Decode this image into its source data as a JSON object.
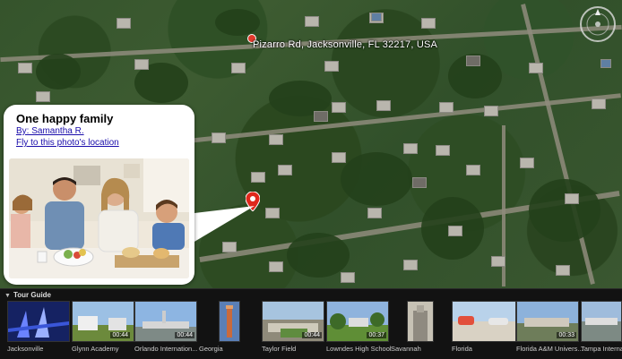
{
  "map": {
    "address_label": "Pizarro Rd, Jacksonville, FL 32217, USA"
  },
  "balloon": {
    "title": "One happy family",
    "author_link": "By: Samantha R.",
    "fly_link": "Fly to this photo's location"
  },
  "tour_guide": {
    "header": "Tour Guide",
    "items": [
      {
        "caption": "Jacksonville",
        "duration": ""
      },
      {
        "caption": "Glynn Academy",
        "duration": "00:44"
      },
      {
        "caption": "Orlando Internation...",
        "duration": "00:44"
      },
      {
        "caption": "Georgia",
        "duration": ""
      },
      {
        "caption": "Taylor Field",
        "duration": "00:44"
      },
      {
        "caption": "Lowndes High School",
        "duration": "00:37"
      },
      {
        "caption": "Savannah",
        "duration": ""
      },
      {
        "caption": "Florida",
        "duration": ""
      },
      {
        "caption": "Florida A&M Univers...",
        "duration": "00:33"
      },
      {
        "caption": "Tampa Interna...",
        "duration": ""
      }
    ]
  }
}
